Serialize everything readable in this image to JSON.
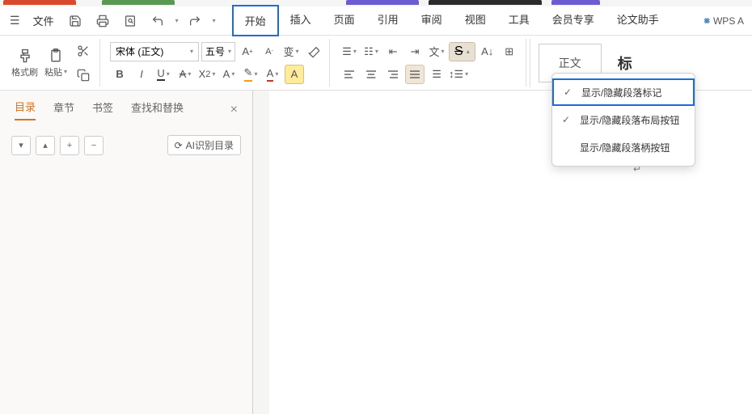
{
  "menu": {
    "file": "文件",
    "tabs": [
      "开始",
      "插入",
      "页面",
      "引用",
      "审阅",
      "视图",
      "工具",
      "会员专享",
      "论文助手"
    ],
    "wps_ai": "WPS A"
  },
  "toolbar": {
    "format_brush": "格式刷",
    "paste": "粘贴",
    "font_name": "宋体 (正文)",
    "font_size": "五号"
  },
  "dropdown": {
    "item1": "显示/隐藏段落标记",
    "item2": "显示/隐藏段落布局按钮",
    "item3": "显示/隐藏段落柄按钮"
  },
  "styles": {
    "normal": "正文",
    "heading": "标"
  },
  "sidebar": {
    "tabs": [
      "目录",
      "章节",
      "书签",
      "查找和替换"
    ],
    "ai_btn": "AI识别目录"
  }
}
